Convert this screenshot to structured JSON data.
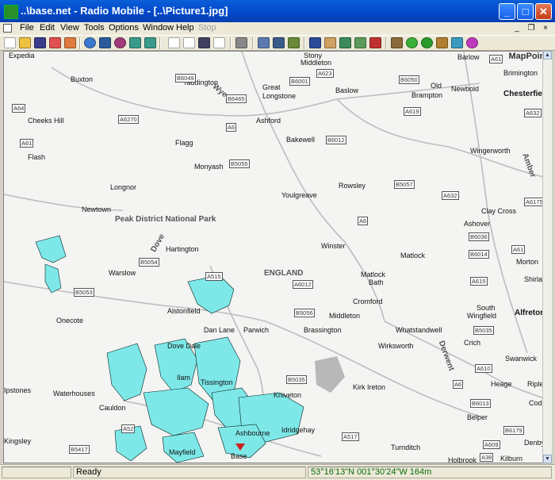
{
  "window": {
    "title": "..\\base.net - Radio Mobile - [..\\Picture1.jpg]",
    "min_glyph": "_",
    "max_glyph": "□",
    "close_glyph": "✕",
    "icon": "radio-mobile-app-icon"
  },
  "menu": [
    "File",
    "Edit",
    "View",
    "Tools",
    "Options",
    "Window",
    "Help",
    "Stop"
  ],
  "mdi_controls": [
    "_",
    "❐",
    "×"
  ],
  "toolbar_icons": [
    "new-icon",
    "open-icon",
    "save-icon",
    "network-props-icon",
    "unit-props-icon",
    "world-icon",
    "map-props-icon",
    "picture-props-icon",
    "back-icon",
    "forward-icon",
    "copy-icon",
    "copy-all-icon",
    "save-picture-icon",
    "paste-icon",
    "print-icon",
    "merge-icon",
    "overlay-icon",
    "render-icon",
    "view-icon",
    "draw-icon",
    "select-icon",
    "grid-icon",
    "cross-icon",
    "antenna-icon",
    "radio-link-icon",
    "coverage-icon",
    "tower-icon",
    "route-icon",
    "cloud-icon"
  ],
  "map": {
    "logo": "MapPoint",
    "places": [
      {
        "label": "Expedia",
        "big": false
      },
      {
        "label": "Buxton",
        "big": false
      },
      {
        "label": "Stony",
        "big": false
      },
      {
        "label": "Middleton",
        "big": false
      },
      {
        "label": "Barlow",
        "big": false
      },
      {
        "label": "Brimington",
        "big": false
      },
      {
        "label": "Taddington",
        "big": false
      },
      {
        "label": "Great",
        "big": false
      },
      {
        "label": "Longstone",
        "big": false
      },
      {
        "label": "Baslow",
        "big": false
      },
      {
        "label": "Old",
        "big": false
      },
      {
        "label": "Brampton",
        "big": false
      },
      {
        "label": "Newbold",
        "big": false
      },
      {
        "label": "Chesterfield",
        "big": true
      },
      {
        "label": "Cheeks Hill",
        "big": false
      },
      {
        "label": "Ashford",
        "big": false
      },
      {
        "label": "Bakewell",
        "big": false
      },
      {
        "label": "Flagg",
        "big": false
      },
      {
        "label": "Wingerworth",
        "big": false
      },
      {
        "label": "Flash",
        "big": false
      },
      {
        "label": "Monyash",
        "big": false
      },
      {
        "label": "Longnor",
        "big": false
      },
      {
        "label": "Youlgreave",
        "big": false
      },
      {
        "label": "Rowsley",
        "big": false
      },
      {
        "label": "Newtown",
        "big": false
      },
      {
        "label": "Clay Cross",
        "big": false
      },
      {
        "label": "Ashover",
        "big": false
      },
      {
        "label": "Hartington",
        "big": false
      },
      {
        "label": "Winster",
        "big": false
      },
      {
        "label": "Matlock",
        "big": false
      },
      {
        "label": "Morton",
        "big": false
      },
      {
        "label": "Warslow",
        "big": false
      },
      {
        "label": "ENGLAND",
        "big": false
      },
      {
        "label": "Matlock",
        "big": false
      },
      {
        "label": "Bath",
        "big": false
      },
      {
        "label": "Shirland",
        "big": false
      },
      {
        "label": "Alstonfield",
        "big": false
      },
      {
        "label": "Cromford",
        "big": false
      },
      {
        "label": "South",
        "big": false
      },
      {
        "label": "Wingfield",
        "big": false
      },
      {
        "label": "Alfreton",
        "big": true
      },
      {
        "label": "Onecote",
        "big": false
      },
      {
        "label": "Dan Lane",
        "big": false
      },
      {
        "label": "Parwich",
        "big": false
      },
      {
        "label": "Brassington",
        "big": false
      },
      {
        "label": "Middleton",
        "big": false
      },
      {
        "label": "Whatstandwell",
        "big": false
      },
      {
        "label": "Dove Dale",
        "big": false
      },
      {
        "label": "Wirksworth",
        "big": false
      },
      {
        "label": "Crich",
        "big": false
      },
      {
        "label": "Swanwick",
        "big": false
      },
      {
        "label": "Ilam",
        "big": false
      },
      {
        "label": "Tissington",
        "big": false
      },
      {
        "label": "Heage",
        "big": false
      },
      {
        "label": "Ripley",
        "big": false
      },
      {
        "label": "Ipstones",
        "big": false
      },
      {
        "label": "Waterhouses",
        "big": false
      },
      {
        "label": "Kniveton",
        "big": false
      },
      {
        "label": "Kirk Ireton",
        "big": false
      },
      {
        "label": "Codnor",
        "big": false
      },
      {
        "label": "Cauldon",
        "big": false
      },
      {
        "label": "Belper",
        "big": false
      },
      {
        "label": "Ashbourne",
        "big": false
      },
      {
        "label": "Idridgehay",
        "big": false
      },
      {
        "label": "Denby",
        "big": false
      },
      {
        "label": "Kingsley",
        "big": false
      },
      {
        "label": "Mayfield",
        "big": false
      },
      {
        "label": "Base",
        "big": false
      },
      {
        "label": "Turnditch",
        "big": false
      },
      {
        "label": "Kilburn",
        "big": false
      },
      {
        "label": "Holbrook",
        "big": false
      }
    ],
    "regions": [
      "Peak District National Park"
    ],
    "rivers": [
      "Wye",
      "Dove",
      "Derwent",
      "Amber"
    ],
    "roads": [
      {
        "label": "A623"
      },
      {
        "label": "B6049"
      },
      {
        "label": "B6001"
      },
      {
        "label": "B6050"
      },
      {
        "label": "A61"
      },
      {
        "label": "B6465"
      },
      {
        "label": "A64"
      },
      {
        "label": "A6"
      },
      {
        "label": "A619"
      },
      {
        "label": "A632"
      },
      {
        "label": "A6270"
      },
      {
        "label": "B6012"
      },
      {
        "label": "A61"
      },
      {
        "label": "B5055"
      },
      {
        "label": "B5057"
      },
      {
        "label": "A632"
      },
      {
        "label": "A6175"
      },
      {
        "label": "A6"
      },
      {
        "label": "B6036"
      },
      {
        "label": "B5054"
      },
      {
        "label": "B6014"
      },
      {
        "label": "A61"
      },
      {
        "label": "A515"
      },
      {
        "label": "A6012"
      },
      {
        "label": "A615"
      },
      {
        "label": "B5053"
      },
      {
        "label": "B5056"
      },
      {
        "label": "B5035"
      },
      {
        "label": "A610"
      },
      {
        "label": "B5035"
      },
      {
        "label": "A6"
      },
      {
        "label": "B6013"
      },
      {
        "label": "A52"
      },
      {
        "label": "A517"
      },
      {
        "label": "B6179"
      },
      {
        "label": "B5417"
      },
      {
        "label": "A609"
      },
      {
        "label": "A38"
      }
    ]
  },
  "status": {
    "ready": "Ready",
    "coords": "53°16'13\"N 001°30'24\"W 164m"
  }
}
